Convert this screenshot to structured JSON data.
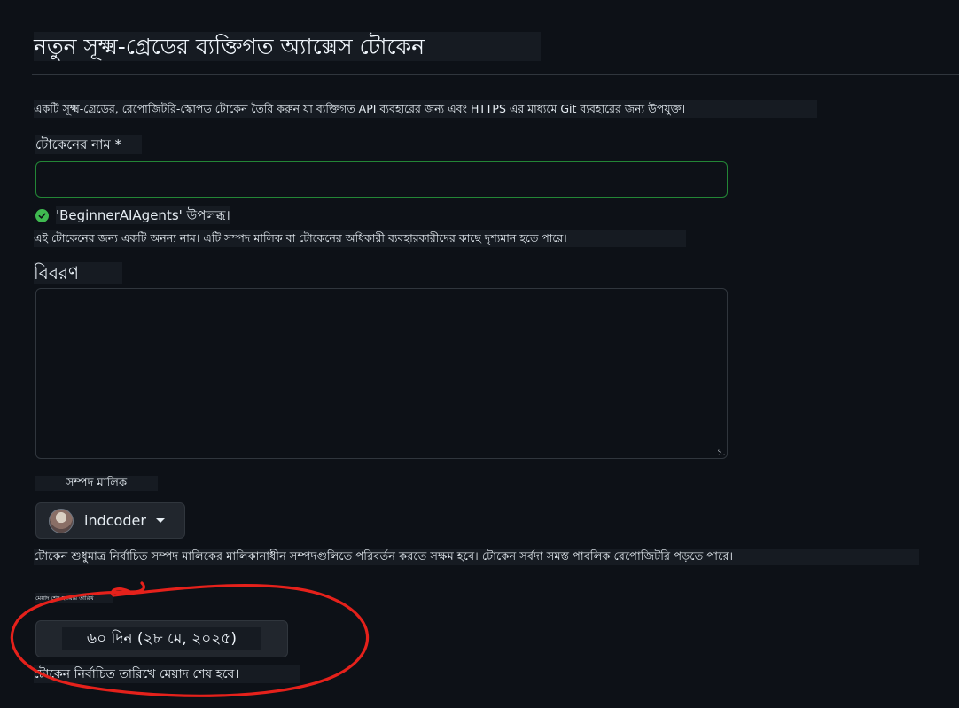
{
  "header": {
    "title": "নতুন সূক্ষ্ম-গ্রেডের ব্যক্তিগত অ্যাক্সেস টোকেন"
  },
  "intro": {
    "text": "একটি সূক্ষ্ম-গ্রেডের, রেপোজিটরি-স্কোপড টোকেন তৈরি করুন যা ব্যক্তিগত API ব্যবহারের জন্য এবং HTTPS এর মাধ্যমে Git ব্যবহারের জন্য উপযুক্ত।"
  },
  "token_name": {
    "label": "টোকেনের নাম *",
    "value": "",
    "availability": "'BeginnerAIAgents' উপলব্ধ।",
    "help": "এই টোকেনের জন্য একটি অনন্য নাম। এটি সম্পদ মালিক বা টোকেনের অধিকারী ব্যবহারকারীদের কাছে দৃশ্যমান হতে পারে।"
  },
  "description": {
    "label": "বিবরণ",
    "value": "",
    "resize_glyph": "১."
  },
  "resource_owner": {
    "label": "সম্পদ মালিক",
    "selected": "indcoder",
    "help": "টোকেন শুধুমাত্র নির্বাচিত সম্পদ মালিকের মালিকানাধীন সম্পদগুলিতে পরিবর্তন করতে সক্ষম হবে। টোকেন সর্বদা সমস্ত পাবলিক রেপোজিটরি পড়তে পারে।"
  },
  "expiration": {
    "label": "মেয়াদ শেষ হওয়ার তারিখ",
    "selected": "৬০ দিন (২৮ মে, ২০২৫)",
    "help": "টোকেন নির্বাচিত তারিখে মেয়াদ শেষ হবে।"
  },
  "colors": {
    "background": "#0d1117",
    "text": "#e6edf3",
    "border": "#30363d",
    "input_focus_border": "#238636",
    "success": "#3fb950",
    "annotation": "#e5211b"
  },
  "icons": {
    "availability": "check-circle-icon",
    "owner_dropdown": "caret-down-icon",
    "owner_avatar": "avatar"
  }
}
